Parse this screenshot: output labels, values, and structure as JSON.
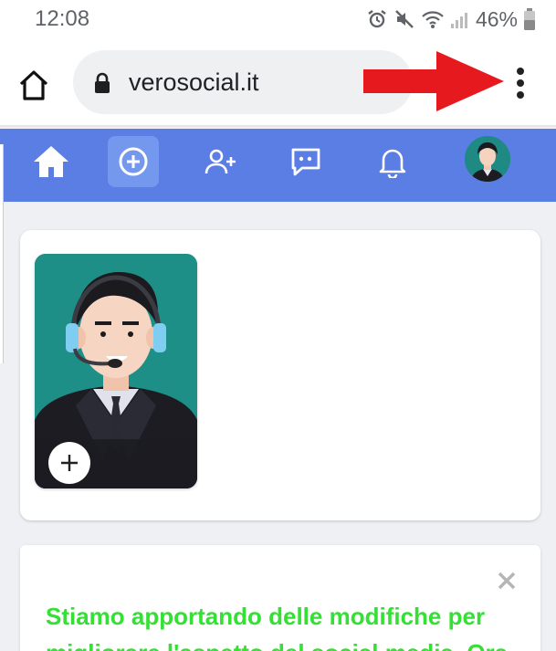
{
  "status_bar": {
    "time": "12:08",
    "battery_percent": "46%",
    "icons": [
      "alarm-icon",
      "mute-icon",
      "wifi-icon",
      "signal-icon",
      "battery-icon"
    ]
  },
  "browser": {
    "url": "verosocial.it",
    "icons": [
      "home-icon",
      "lock-icon",
      "more-vert-icon"
    ],
    "annotation": "red-arrow"
  },
  "nav": {
    "items": [
      "home-icon",
      "add-circle-icon",
      "add-friend-icon",
      "messages-icon",
      "notifications-icon",
      "avatar"
    ],
    "active": "add-circle-icon",
    "colors": {
      "background": "#5b7ee5",
      "active": "#7598ef"
    }
  },
  "story": {
    "add_icon": "plus-icon"
  },
  "notice": {
    "text": "Stiamo apportando delle modifiche per migliorare l'aspetto del social media. Ora",
    "color": "#33e033",
    "close_icon": "close-icon"
  }
}
